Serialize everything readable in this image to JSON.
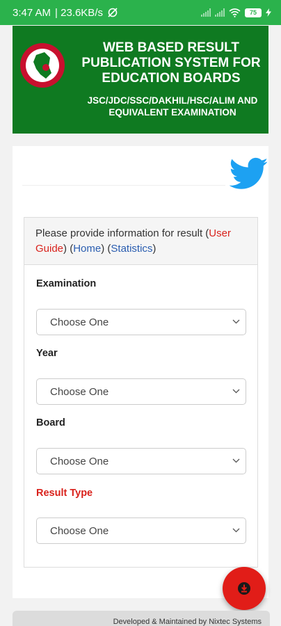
{
  "status_bar": {
    "time": "3:47 AM",
    "speed": "| 23.6KB/s",
    "battery": "75"
  },
  "header": {
    "title": "WEB BASED RESULT PUBLICATION SYSTEM FOR EDUCATION BOARDS",
    "subtitle": "JSC/JDC/SSC/DAKHIL/HSC/ALIM AND EQUIVALENT EXAMINATION"
  },
  "info": {
    "prefix": "Please provide information for result (",
    "user_guide": "User Guide",
    "sep1": ") (",
    "home": "Home",
    "sep2": ") (",
    "statistics": "Statistics",
    "suffix": ")"
  },
  "form": {
    "examination": {
      "label": "Examination",
      "value": "Choose One"
    },
    "year": {
      "label": "Year",
      "value": "Choose One"
    },
    "board": {
      "label": "Board",
      "value": "Choose One"
    },
    "result_type": {
      "label": "Result Type",
      "value": "Choose One"
    }
  },
  "footer": {
    "text": "Developed & Maintained by Nixtec Systems"
  },
  "colors": {
    "header_green": "#0f7a21",
    "status_green": "#2bb24c",
    "accent_red": "#d9221c",
    "link_blue": "#2a5db0"
  }
}
